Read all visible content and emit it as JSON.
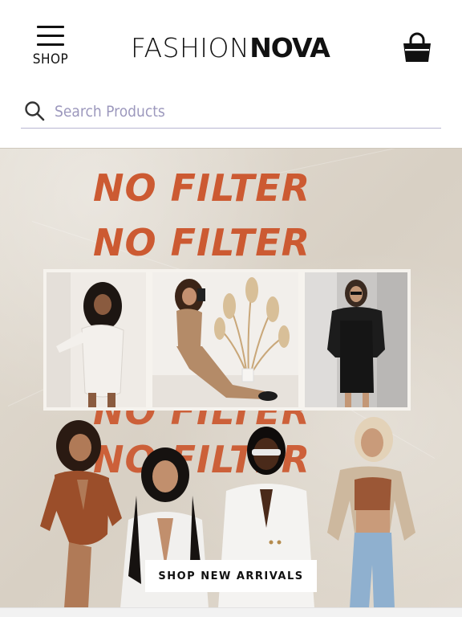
{
  "header": {
    "menu_label": "SHOP",
    "logo_part1": "FASHION",
    "logo_part2": "NOVA"
  },
  "search": {
    "placeholder": "Search Products",
    "value": ""
  },
  "hero": {
    "headline_lines": [
      "NO FILTER",
      "NO FILTER",
      "NO FILTER",
      "NO FILTER"
    ],
    "cta_label": "SHOP NEW ARRIVALS"
  },
  "colors": {
    "accent": "#cc5a32",
    "paper": "#ddd6cb",
    "search_border": "#b9b6d2",
    "placeholder": "#9c98bd"
  },
  "icons": {
    "menu": "hamburger-menu-icon",
    "cart": "shopping-bag-icon",
    "search": "search-icon"
  }
}
